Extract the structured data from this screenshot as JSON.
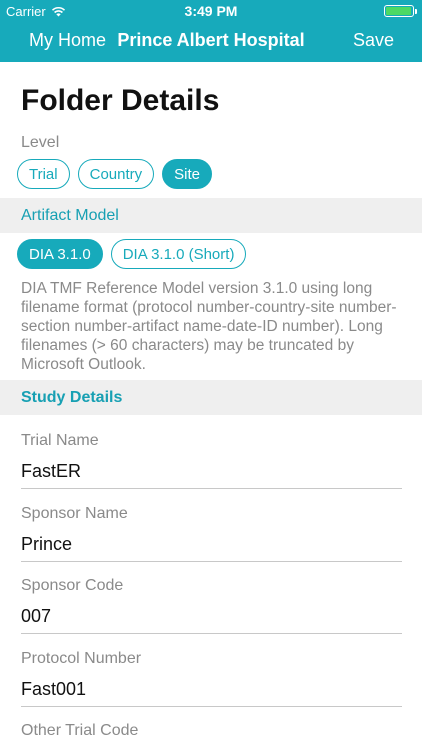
{
  "status": {
    "carrier": "Carrier",
    "time": "3:49 PM"
  },
  "nav": {
    "back": "My Home",
    "title": "Prince Albert Hospital",
    "save": "Save"
  },
  "page": {
    "title": "Folder Details"
  },
  "level": {
    "label": "Level",
    "options": [
      "Trial",
      "Country",
      "Site"
    ],
    "selected": "Site"
  },
  "artifact": {
    "header": "Artifact Model",
    "options": [
      "DIA 3.1.0",
      "DIA 3.1.0 (Short)"
    ],
    "selected": "DIA 3.1.0",
    "description": "DIA TMF Reference Model version 3.1.0 using long filename format (protocol number-country-site number-section number-artifact name-date-ID number). Long filenames (> 60 characters) may be truncated by Microsoft Outlook."
  },
  "study": {
    "header": "Study Details",
    "fields": [
      {
        "label": "Trial Name",
        "value": "FastER"
      },
      {
        "label": "Sponsor Name",
        "value": "Prince"
      },
      {
        "label": "Sponsor Code",
        "value": "007"
      },
      {
        "label": "Protocol Number",
        "value": "Fast001"
      },
      {
        "label": "Other Trial Code",
        "value": ""
      }
    ]
  }
}
